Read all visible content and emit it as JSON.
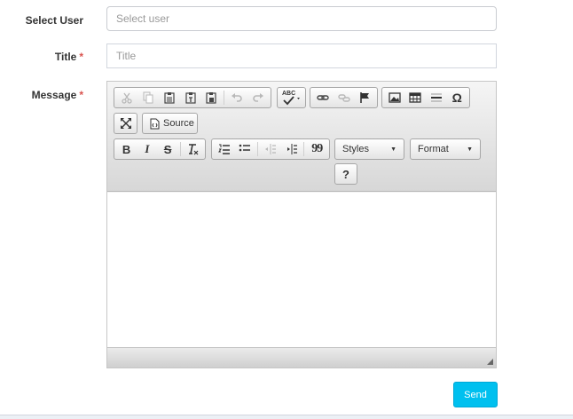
{
  "form": {
    "select_user_label": "Select User",
    "select_user_placeholder": "Select user",
    "title_label": "Title",
    "title_placeholder": "Title",
    "message_label": "Message",
    "required_mark": "*"
  },
  "editor": {
    "toolbar_row1": {
      "clipboard": [
        "cut-icon",
        "copy-icon",
        "paste-icon",
        "paste-text-icon",
        "paste-from-word-icon",
        "undo-icon",
        "redo-icon"
      ],
      "spellcheck": "spellcheck-icon",
      "links": [
        "link-icon",
        "unlink-icon",
        "anchor-icon"
      ],
      "insert": [
        "image-icon",
        "table-icon",
        "horizontal-line-icon",
        "special-char-icon"
      ]
    },
    "source_label": "Source",
    "styles_label": "Styles",
    "format_label": "Format",
    "help_label": "?",
    "special_char_glyph": "Ω",
    "bold_glyph": "B",
    "italic_glyph": "I",
    "strike_glyph": "S",
    "blockquote_glyph": "99",
    "spellcheck_glyph": "ABC"
  },
  "actions": {
    "send_label": "Send"
  },
  "colors": {
    "send_button": "#00c0ef",
    "required": "#d9534f"
  }
}
